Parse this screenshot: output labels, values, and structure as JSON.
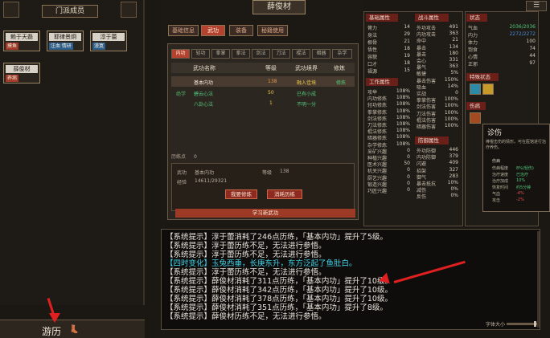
{
  "sect": {
    "title": "门派成员",
    "members": [
      {
        "name": "赖于天磊",
        "tag": "摸鱼"
      },
      {
        "name": "耶律景炯",
        "tag": "注血 情研"
      },
      {
        "name": "淳于蕾",
        "tag": "漫寞"
      },
      {
        "name": "薛俊材",
        "tag": "养病"
      }
    ]
  },
  "travel": {
    "label": "游历",
    "icon": "boot-icon"
  },
  "character": {
    "name": "薛俊材"
  },
  "main_tabs": [
    "基础信息",
    "武功",
    "装备",
    "秘籍使用"
  ],
  "sub_tabs": [
    "内功",
    "轻功",
    "拳掌",
    "拳法",
    "剑法",
    "刀法",
    "棍法",
    "暗器",
    "杂学"
  ],
  "skill_table": {
    "headers": [
      "武功名称",
      "等级",
      "武功境界",
      "修炼"
    ],
    "rows": [
      {
        "type": "",
        "name": "基本内功",
        "level": "138",
        "realm": "融入佳境",
        "train": "修炼"
      },
      {
        "type": "绝学",
        "name": "碧云心法",
        "level": "50",
        "realm": "已有小成",
        "train": ""
      },
      {
        "type": "",
        "name": "八卦心法",
        "level": "1",
        "realm": "不明一分",
        "train": ""
      }
    ]
  },
  "practice": {
    "label": "历练点",
    "value": "0"
  },
  "detail": {
    "skill_label": "武功",
    "skill_value": "基本内功",
    "level_label": "等级",
    "level_value": "138",
    "exp_label": "经验",
    "exp_value": "14611/29321"
  },
  "buttons": {
    "focus": "我要修炼",
    "consume": "消耗历练",
    "learn": "学习新武功"
  },
  "attributes": {
    "basic_title": "基础属性",
    "basic": [
      {
        "label": "膂力",
        "value": "14"
      },
      {
        "label": "身法",
        "value": "29"
      },
      {
        "label": "根骨",
        "value": "21"
      },
      {
        "label": "悟性",
        "value": "18"
      },
      {
        "label": "容貌",
        "value": "19"
      },
      {
        "label": "口才",
        "value": "18"
      },
      {
        "label": "福源",
        "value": "15"
      }
    ],
    "work_title": "工作属性",
    "work": [
      {
        "label": "攻举",
        "value": "108%"
      },
      {
        "label": "内功修炼",
        "value": "108%"
      },
      {
        "label": "轻功修炼",
        "value": "108%"
      },
      {
        "label": "拳掌修炼",
        "value": "108%"
      },
      {
        "label": "剑法修炼",
        "value": "108%"
      },
      {
        "label": "刀法修炼",
        "value": "108%"
      },
      {
        "label": "棍法修炼",
        "value": "108%"
      },
      {
        "label": "暗器修炼",
        "value": "108%"
      },
      {
        "label": "杂学修炼",
        "value": "108%"
      },
      {
        "label": "采矿兴趣",
        "value": "0"
      },
      {
        "label": "种植兴趣",
        "value": "0"
      },
      {
        "label": "医术兴趣",
        "value": "50"
      },
      {
        "label": "机关兴趣",
        "value": "0"
      },
      {
        "label": "厨艺兴趣",
        "value": "0"
      },
      {
        "label": "锻造兴趣",
        "value": "0"
      },
      {
        "label": "巧匠兴趣",
        "value": "0"
      }
    ],
    "combat_title": "战斗属性",
    "combat": [
      {
        "label": "外功攻击",
        "value": "491"
      },
      {
        "label": "内功攻击",
        "value": "363"
      },
      {
        "label": "命中",
        "value": "21"
      },
      {
        "label": "暴击",
        "value": "134"
      },
      {
        "label": "暴击",
        "value": "180"
      },
      {
        "label": "会心",
        "value": "331"
      },
      {
        "label": "暴气",
        "value": "363"
      },
      {
        "label": "敏捷",
        "value": "5%"
      },
      {
        "label": "暴击伤害",
        "value": "150%"
      },
      {
        "label": "吸血",
        "value": "14%"
      },
      {
        "label": "实战",
        "value": "0"
      },
      {
        "label": "拳掌伤害",
        "value": "100%"
      },
      {
        "label": "剑法伤害",
        "value": "100%"
      },
      {
        "label": "刀法伤害",
        "value": "100%"
      },
      {
        "label": "棍法伤害",
        "value": "100%"
      },
      {
        "label": "暗器伤害",
        "value": "100%"
      }
    ],
    "defense_title": "防御属性",
    "defense": [
      {
        "label": "外功防御",
        "value": "446"
      },
      {
        "label": "内功防御",
        "value": "379"
      },
      {
        "label": "闪避",
        "value": "409"
      },
      {
        "label": "招架",
        "value": "327"
      },
      {
        "label": "御气",
        "value": "283"
      },
      {
        "label": "暴击抵抗",
        "value": "10%"
      },
      {
        "label": "减伤",
        "value": "0%"
      },
      {
        "label": "反伤",
        "value": "0%"
      }
    ]
  },
  "status": {
    "title": "状态",
    "lines": [
      {
        "label": "气血",
        "value": "2036/2036"
      },
      {
        "label": "内力",
        "value": "2272/2272"
      },
      {
        "label": "体力",
        "value": "100"
      },
      {
        "label": "饱食",
        "value": "74"
      },
      {
        "label": "心情",
        "value": "44"
      },
      {
        "label": "正邪",
        "value": "97"
      }
    ],
    "special_title": "特殊状态",
    "injury_title": "伤病"
  },
  "tooltip": {
    "title": "诊伤",
    "desc": "棒棍击伤的情形。可在医馆进行治疗养伤。",
    "sub": "伤病",
    "items": [
      {
        "label": "伤病程度",
        "value": "8%(轻伤)"
      },
      {
        "label": "治疗速度",
        "value": "已治疗"
      },
      {
        "label": "治疗加成",
        "value": "10%"
      },
      {
        "label": "恢复时间",
        "value": "约5分钟"
      },
      {
        "label": "气血",
        "value": "-4%"
      },
      {
        "label": "攻击",
        "value": "-2%"
      }
    ]
  },
  "log": {
    "lines": [
      {
        "text": "【系统提示】淳于蕾消耗了246点历练，「基本内功」提升了5级。",
        "color": "#e8e4dc"
      },
      {
        "text": "【系统提示】淳于蕾历练不足，无法进行参悟。",
        "color": "#e8e4dc"
      },
      {
        "text": "【系统提示】淳于蕾历练不足，无法进行参悟。",
        "color": "#e8e4dc"
      },
      {
        "text": "【四时变化】玉兔西垂，长庚东升，东方泛起了鱼肚白。",
        "color": "#3fd4ea"
      },
      {
        "text": "【系统提示】淳于蕾历练不足，无法进行参悟。",
        "color": "#e8e4dc"
      },
      {
        "text": "【系统提示】薛俊材消耗了311点历练，「基本内功」提升了10级。",
        "color": "#e8e4dc"
      },
      {
        "text": "【系统提示】薛俊材消耗了342点历练，「基本内功」提升了10级。",
        "color": "#e8e4dc"
      },
      {
        "text": "【系统提示】薛俊材消耗了378点历练，「基本内功」提升了10级。",
        "color": "#e8e4dc"
      },
      {
        "text": "【系统提示】薛俊材消耗了351点历练，「基本内功」提升了8级。",
        "color": "#e8e4dc"
      },
      {
        "text": "【系统提示】薛俊材历练不足，无法进行参悟。",
        "color": "#e8e4dc"
      }
    ],
    "font_size_label": "字体大小"
  }
}
